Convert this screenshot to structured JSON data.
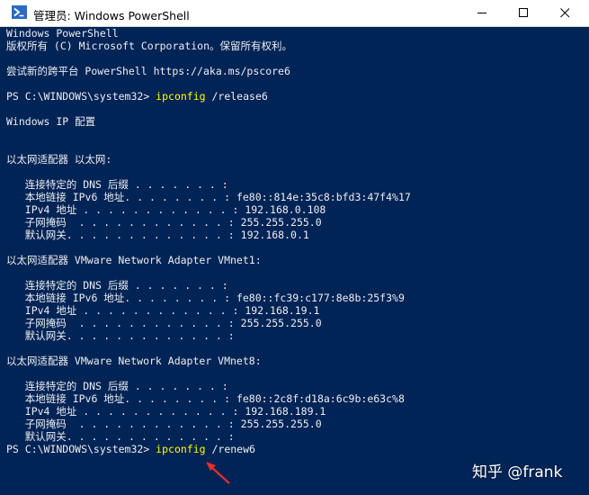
{
  "window": {
    "title": "管理员: Windows PowerShell",
    "icon": "powershell-icon",
    "controls": [
      "minimize-icon",
      "maximize-icon",
      "close-icon"
    ],
    "background_color": "#012456",
    "text_color": "#eeedf0",
    "command_color": "#ffff00"
  },
  "console": {
    "header_line1": "Windows PowerShell",
    "header_line2": "版权所有 (C) Microsoft Corporation。保留所有权利。",
    "header_line3": "尝试新的跨平台 PowerShell https://aka.ms/pscore6",
    "cmd1_prompt": "PS C:\\WINDOWS\\system32> ",
    "cmd1_name": "ipconfig",
    "cmd1_args": " /release6",
    "ip_config_title": "Windows IP 配置",
    "adapters": [
      {
        "header": "以太网适配器 以太网:",
        "rows": [
          {
            "label": "   连接特定的 DNS 后缀 . . . . . . . : ",
            "value": ""
          },
          {
            "label": "   本地链接 IPv6 地址. . . . . . . . : ",
            "value": "fe80::814e:35c8:bfd3:47f4%17"
          },
          {
            "label": "   IPv4 地址 . . . . . . . . . . . . : ",
            "value": "192.168.0.108"
          },
          {
            "label": "   子网掩码  . . . . . . . . . . . . : ",
            "value": "255.255.255.0"
          },
          {
            "label": "   默认网关. . . . . . . . . . . . . : ",
            "value": "192.168.0.1"
          }
        ]
      },
      {
        "header": "以太网适配器 VMware Network Adapter VMnet1:",
        "rows": [
          {
            "label": "   连接特定的 DNS 后缀 . . . . . . . : ",
            "value": ""
          },
          {
            "label": "   本地链接 IPv6 地址. . . . . . . . : ",
            "value": "fe80::fc39:c177:8e8b:25f3%9"
          },
          {
            "label": "   IPv4 地址 . . . . . . . . . . . . : ",
            "value": "192.168.19.1"
          },
          {
            "label": "   子网掩码  . . . . . . . . . . . . : ",
            "value": "255.255.255.0"
          },
          {
            "label": "   默认网关. . . . . . . . . . . . . : ",
            "value": ""
          }
        ]
      },
      {
        "header": "以太网适配器 VMware Network Adapter VMnet8:",
        "rows": [
          {
            "label": "   连接特定的 DNS 后缀 . . . . . . . : ",
            "value": ""
          },
          {
            "label": "   本地链接 IPv6 地址. . . . . . . . : ",
            "value": "fe80::2c8f:d18a:6c9b:e63c%8"
          },
          {
            "label": "   IPv4 地址 . . . . . . . . . . . . : ",
            "value": "192.168.189.1"
          },
          {
            "label": "   子网掩码  . . . . . . . . . . . . : ",
            "value": "255.255.255.0"
          },
          {
            "label": "   默认网关. . . . . . . . . . . . . : ",
            "value": ""
          }
        ]
      }
    ],
    "cmd2_prompt": "PS C:\\WINDOWS\\system32> ",
    "cmd2_name": "ipconfig",
    "cmd2_args": " /renew6"
  },
  "annotation": {
    "arrow_icon": "red-arrow-icon",
    "arrow_color": "#e8302c"
  },
  "watermark": {
    "text": "知乎 @frank"
  }
}
